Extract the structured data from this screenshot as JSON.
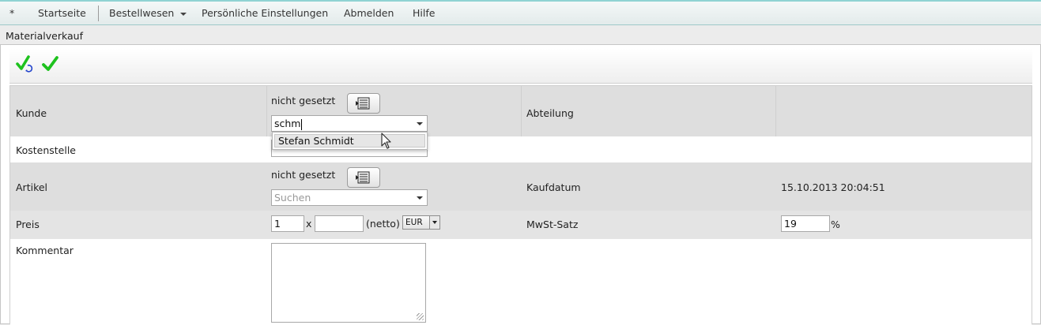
{
  "menu": {
    "star": "*",
    "items": [
      {
        "label": "Startseite"
      },
      {
        "label": "Bestellwesen",
        "has_dropdown": true
      },
      {
        "label": "Persönliche Einstellungen"
      },
      {
        "label": "Abmelden"
      },
      {
        "label": "Hilfe"
      }
    ]
  },
  "panel": {
    "title": "Materialverkauf"
  },
  "toolbar": {
    "icons": [
      "check-refresh-icon",
      "check-icon"
    ]
  },
  "form": {
    "kunde": {
      "label": "Kunde",
      "status": "nicht gesetzt",
      "search_value": "schm",
      "dropdown_option": "Stefan Schmidt"
    },
    "abteilung": {
      "label": "Abteilung"
    },
    "kostenstelle": {
      "label": "Kostenstelle"
    },
    "artikel": {
      "label": "Artikel",
      "status": "nicht gesetzt",
      "search_placeholder": "Suchen"
    },
    "kaufdatum": {
      "label": "Kaufdatum",
      "value": "15.10.2013 20:04:51"
    },
    "preis": {
      "label": "Preis",
      "quantity": "1",
      "times": "x",
      "price": "",
      "netto": "(netto)",
      "currency": "EUR"
    },
    "mwst": {
      "label": "MwSt-Satz",
      "value": "19",
      "unit": "%"
    },
    "kommentar": {
      "label": "Kommentar",
      "value": ""
    }
  },
  "colors": {
    "menu_accent": "#8fd3d3",
    "check_green": "#22cc22",
    "refresh_blue": "#2244cc",
    "row_grey": "#dedede"
  }
}
